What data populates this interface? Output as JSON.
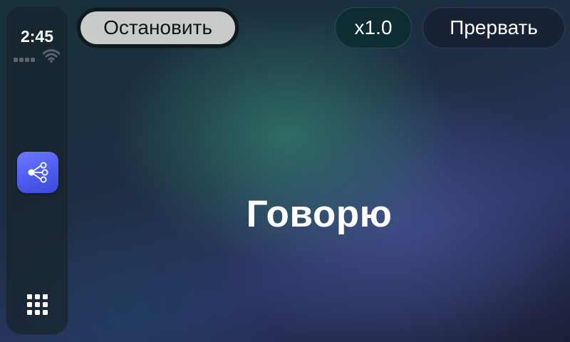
{
  "status_bar": {
    "time": "2:45",
    "wifi_icon": "wifi-icon",
    "signal_icon": "cellular-signal-icon"
  },
  "sidebar": {
    "active_app_icon": "share-nodes-icon",
    "active_app_color": "#5864f5",
    "app_grid_icon": "app-grid-icon"
  },
  "toolbar": {
    "stop_label": "Остановить",
    "speed_label": "x1.0",
    "abort_label": "Прервать"
  },
  "main": {
    "status_text": "Говорю"
  }
}
